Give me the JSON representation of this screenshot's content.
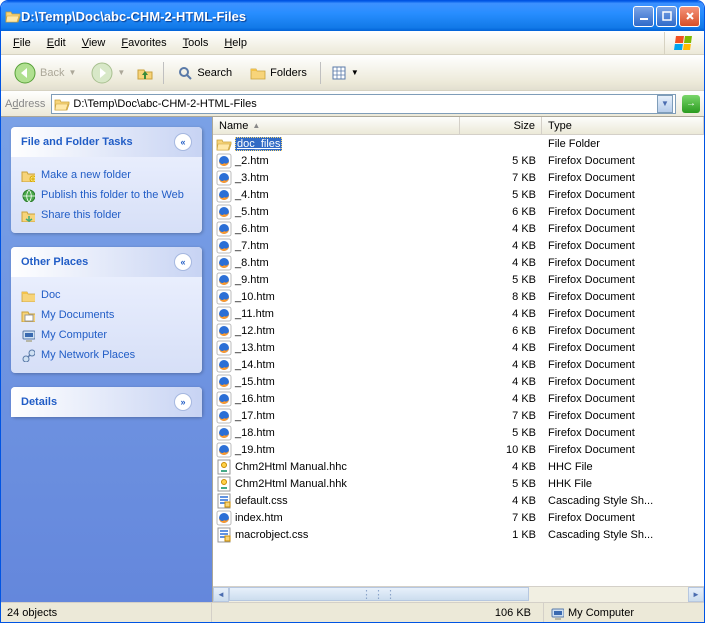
{
  "window": {
    "title": "D:\\Temp\\Doc\\abc-CHM-2-HTML-Files"
  },
  "menu": {
    "file": "File",
    "edit": "Edit",
    "view": "View",
    "favorites": "Favorites",
    "tools": "Tools",
    "help": "Help"
  },
  "toolbar": {
    "back": "Back",
    "search": "Search",
    "folders": "Folders"
  },
  "address": {
    "label": "Address",
    "path": "D:\\Temp\\Doc\\abc-CHM-2-HTML-Files"
  },
  "side": {
    "tasks": {
      "title": "File and Folder Tasks",
      "make": "Make a new folder",
      "publish": "Publish this folder to the Web",
      "share": "Share this folder"
    },
    "places": {
      "title": "Other Places",
      "doc": "Doc",
      "mydocs": "My Documents",
      "mycomp": "My Computer",
      "net": "My Network Places"
    },
    "details": {
      "title": "Details"
    }
  },
  "cols": {
    "name": "Name",
    "size": "Size",
    "type": "Type"
  },
  "files": [
    {
      "name": "doc_files",
      "size": "",
      "type": "File Folder",
      "icon": "folder",
      "sel": true
    },
    {
      "name": "_2.htm",
      "size": "5 KB",
      "type": "Firefox Document",
      "icon": "ff"
    },
    {
      "name": "_3.htm",
      "size": "7 KB",
      "type": "Firefox Document",
      "icon": "ff"
    },
    {
      "name": "_4.htm",
      "size": "5 KB",
      "type": "Firefox Document",
      "icon": "ff"
    },
    {
      "name": "_5.htm",
      "size": "6 KB",
      "type": "Firefox Document",
      "icon": "ff"
    },
    {
      "name": "_6.htm",
      "size": "4 KB",
      "type": "Firefox Document",
      "icon": "ff"
    },
    {
      "name": "_7.htm",
      "size": "4 KB",
      "type": "Firefox Document",
      "icon": "ff"
    },
    {
      "name": "_8.htm",
      "size": "4 KB",
      "type": "Firefox Document",
      "icon": "ff"
    },
    {
      "name": "_9.htm",
      "size": "5 KB",
      "type": "Firefox Document",
      "icon": "ff"
    },
    {
      "name": "_10.htm",
      "size": "8 KB",
      "type": "Firefox Document",
      "icon": "ff"
    },
    {
      "name": "_11.htm",
      "size": "4 KB",
      "type": "Firefox Document",
      "icon": "ff"
    },
    {
      "name": "_12.htm",
      "size": "6 KB",
      "type": "Firefox Document",
      "icon": "ff"
    },
    {
      "name": "_13.htm",
      "size": "4 KB",
      "type": "Firefox Document",
      "icon": "ff"
    },
    {
      "name": "_14.htm",
      "size": "4 KB",
      "type": "Firefox Document",
      "icon": "ff"
    },
    {
      "name": "_15.htm",
      "size": "4 KB",
      "type": "Firefox Document",
      "icon": "ff"
    },
    {
      "name": "_16.htm",
      "size": "4 KB",
      "type": "Firefox Document",
      "icon": "ff"
    },
    {
      "name": "_17.htm",
      "size": "7 KB",
      "type": "Firefox Document",
      "icon": "ff"
    },
    {
      "name": "_18.htm",
      "size": "5 KB",
      "type": "Firefox Document",
      "icon": "ff"
    },
    {
      "name": "_19.htm",
      "size": "10 KB",
      "type": "Firefox Document",
      "icon": "ff"
    },
    {
      "name": "Chm2Html Manual.hhc",
      "size": "4 KB",
      "type": "HHC File",
      "icon": "hh"
    },
    {
      "name": "Chm2Html Manual.hhk",
      "size": "5 KB",
      "type": "HHK File",
      "icon": "hh"
    },
    {
      "name": "default.css",
      "size": "4 KB",
      "type": "Cascading Style Sh...",
      "icon": "css"
    },
    {
      "name": "index.htm",
      "size": "7 KB",
      "type": "Firefox Document",
      "icon": "ff"
    },
    {
      "name": "macrobject.css",
      "size": "1 KB",
      "type": "Cascading Style Sh...",
      "icon": "css"
    }
  ],
  "status": {
    "objects": "24 objects",
    "size": "106 KB",
    "location": "My Computer"
  }
}
